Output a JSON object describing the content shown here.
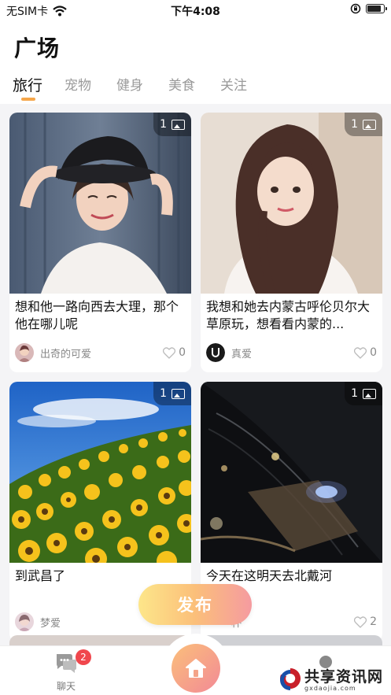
{
  "status_bar": {
    "carrier": "无SIM卡",
    "time": "下午4:08",
    "battery_level": 0.85
  },
  "header": {
    "title": "广场",
    "tabs": [
      {
        "label": "旅行",
        "active": true
      },
      {
        "label": "宠物",
        "active": false
      },
      {
        "label": "健身",
        "active": false
      },
      {
        "label": "美食",
        "active": false
      },
      {
        "label": "关注",
        "active": false
      }
    ]
  },
  "posts": [
    {
      "image_count": "1",
      "title": "想和他一路向西去大理，那个他在哪儿呢",
      "author": "出奇的可爱",
      "likes": "0",
      "image_icon": "woman-black-hat-photo"
    },
    {
      "image_count": "1",
      "title": "我想和她去内蒙古呼伦贝尔大草原玩，想看看内蒙的...",
      "author": "真爱",
      "likes": "0",
      "image_icon": "woman-long-hair-photo"
    },
    {
      "image_count": "1",
      "title": "到武昌了",
      "author": "梦爱",
      "likes": "",
      "image_icon": "sunflower-field-photo"
    },
    {
      "image_count": "1",
      "title": "今天在这明天去北戴河",
      "author": "杯",
      "likes": "2",
      "image_icon": "night-car-photo"
    }
  ],
  "publish_button": {
    "label": "发布"
  },
  "bottom_nav": {
    "chat_label": "聊天",
    "chat_badge": "2"
  },
  "watermark": {
    "text": "共享资讯网",
    "sub": "gxdaojia.com"
  },
  "colors": {
    "accent": "#f5a64a",
    "badge": "#f0474d",
    "gradient_start": "#fde68a",
    "gradient_end": "#f59ba0"
  }
}
